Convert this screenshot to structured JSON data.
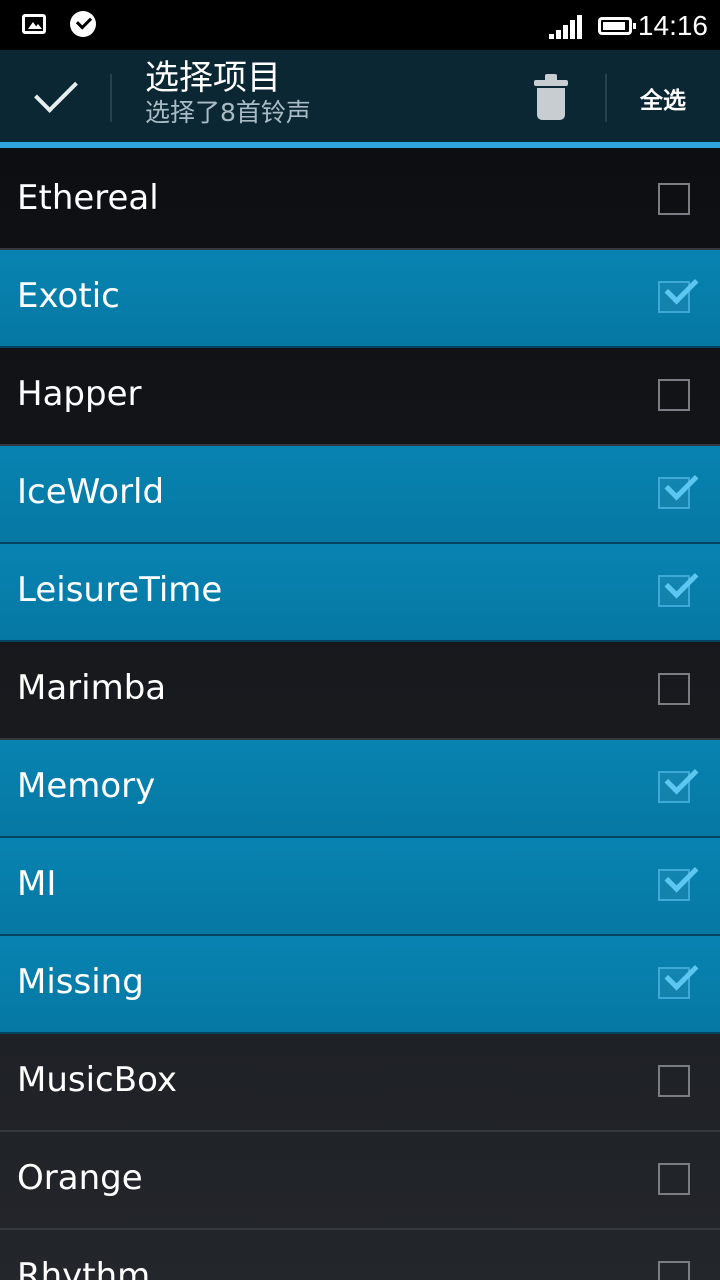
{
  "status_bar": {
    "time": "14:16",
    "icons": [
      "image-icon",
      "check-circle-icon",
      "signal-icon",
      "battery-icon"
    ]
  },
  "action_bar": {
    "title": "选择项目",
    "subtitle": "选择了8首铃声",
    "select_all_label": "全选",
    "icons": [
      "checkmark-icon",
      "trash-icon"
    ]
  },
  "colors": {
    "action_bar_bg": "#0b2733",
    "accent_line": "#2ea3dc",
    "selected_row": "#0883b1",
    "check_mark": "#5cc7f0"
  },
  "list": {
    "items": [
      {
        "label": "Ethereal",
        "checked": false
      },
      {
        "label": "Exotic",
        "checked": true
      },
      {
        "label": "Happer",
        "checked": false
      },
      {
        "label": "IceWorld",
        "checked": true
      },
      {
        "label": "LeisureTime",
        "checked": true
      },
      {
        "label": "Marimba",
        "checked": false
      },
      {
        "label": "Memory",
        "checked": true
      },
      {
        "label": "MI",
        "checked": true
      },
      {
        "label": "Missing",
        "checked": true
      },
      {
        "label": "MusicBox",
        "checked": false
      },
      {
        "label": "Orange",
        "checked": false
      },
      {
        "label": "Rhythm",
        "checked": false
      }
    ]
  }
}
